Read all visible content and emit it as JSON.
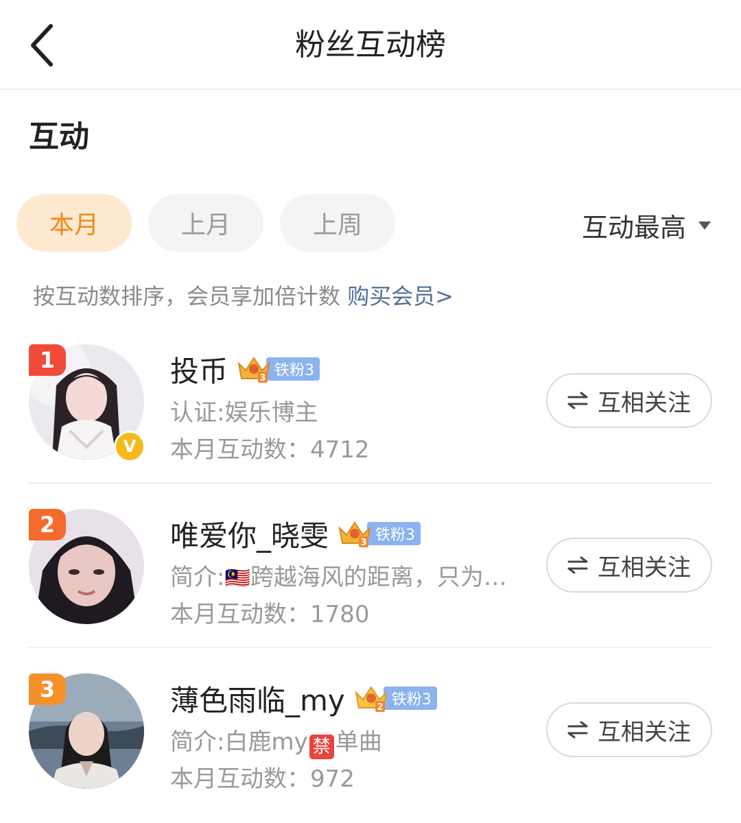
{
  "header": {
    "title": "粉丝互动榜",
    "back_icon": "chevron-left-icon"
  },
  "section": {
    "title": "互动"
  },
  "filters": {
    "tabs": [
      {
        "label": "本月",
        "active": true
      },
      {
        "label": "上月",
        "active": false
      },
      {
        "label": "上周",
        "active": false
      }
    ],
    "sort_label": "互动最高",
    "sort_icon": "caret-down-icon"
  },
  "hint": {
    "text": "按互动数排序，会员享加倍计数",
    "link": "购买会员>"
  },
  "colors": {
    "accent": "#ef8a1b",
    "active_tab_bg": "#fde9cf",
    "link": "#4f6f96",
    "level_pill": "#8ab3f0"
  },
  "fans": [
    {
      "rank": "1",
      "rank_color": "#f04b3a",
      "name": "投币",
      "level_label": "铁粉3",
      "crown_number": "3",
      "intro": "认证:娱乐博主",
      "count": "本月互动数：4712",
      "verified": true,
      "follow_label": "互相关注"
    },
    {
      "rank": "2",
      "rank_color": "#f36a2a",
      "name": "唯爱你_晓雯",
      "level_label": "铁粉3",
      "crown_number": "3",
      "intro_prefix": "简介:",
      "intro_flag": "🇲🇾",
      "intro_rest": "跨越海风的距离，只为…",
      "count": "本月互动数：1780",
      "verified": false,
      "follow_label": "互相关注"
    },
    {
      "rank": "3",
      "rank_color": "#f5902a",
      "name": "薄色雨临_my",
      "level_label": "铁粉3",
      "crown_number": "2",
      "intro_prefix": "简介:白鹿my",
      "intro_tag": "禁",
      "intro_rest": "单曲",
      "count": "本月互动数：972",
      "verified": false,
      "follow_label": "互相关注"
    }
  ]
}
